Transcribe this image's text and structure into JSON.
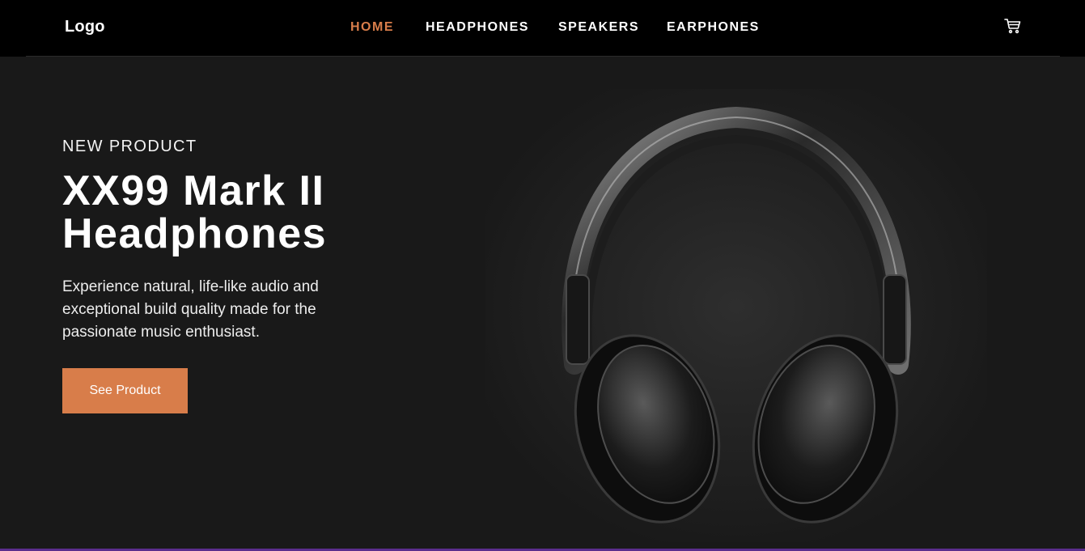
{
  "header": {
    "logo": "Logo",
    "nav": [
      {
        "label": "HOME",
        "active": true
      },
      {
        "label": "HEADPHONES",
        "active": false
      },
      {
        "label": "SPEAKERS",
        "active": false
      },
      {
        "label": "EARPHONES",
        "active": false
      }
    ],
    "cart_icon": "cart-icon"
  },
  "hero": {
    "overline": "NEW PRODUCT",
    "title": "XX99 Mark II Headphones",
    "description": "Experience natural, life-like audio and exceptional build quality made for the passionate music enthusiast.",
    "cta_label": "See Product",
    "image": "headphones-image"
  },
  "colors": {
    "accent": "#d87d4a",
    "header_bg": "#000000",
    "hero_bg": "#191919",
    "text": "#ffffff"
  }
}
